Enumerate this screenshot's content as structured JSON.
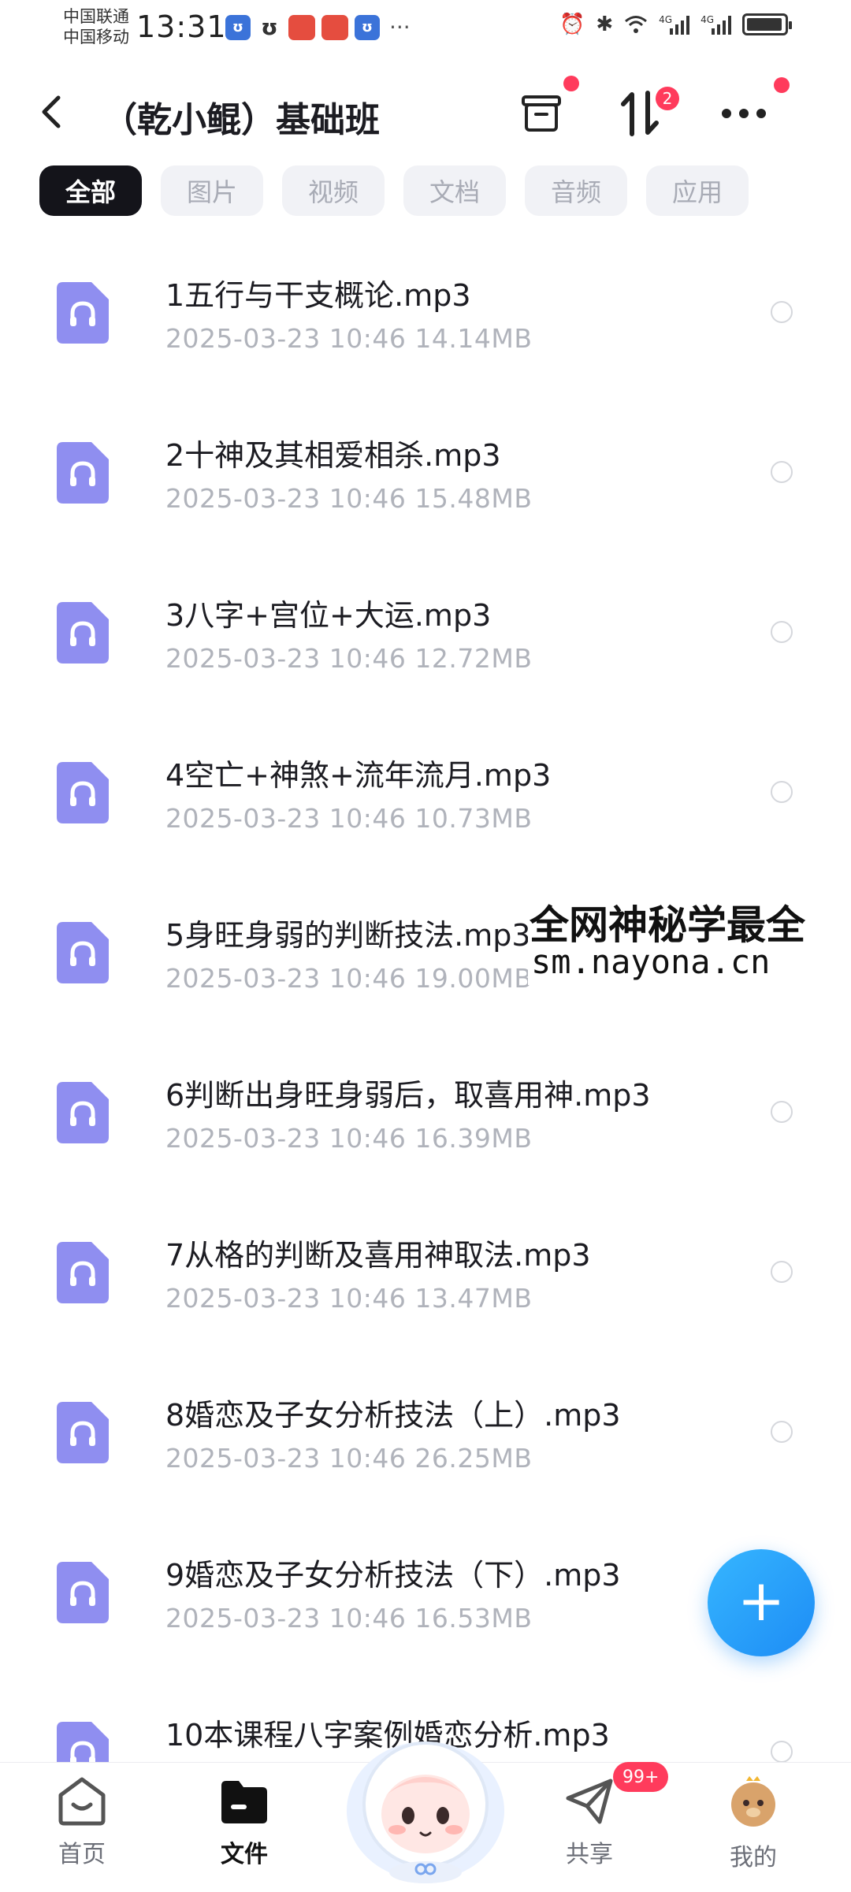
{
  "status_bar": {
    "carrier_1": "中国联通",
    "carrier_2": "中国移动",
    "time": "13:31",
    "more": "···"
  },
  "header": {
    "title": "（乾小鲲）基础班",
    "sort_badge": "2"
  },
  "tabs": [
    {
      "label": "全部",
      "active": true
    },
    {
      "label": "图片"
    },
    {
      "label": "视频"
    },
    {
      "label": "文档"
    },
    {
      "label": "音频"
    },
    {
      "label": "应用"
    }
  ],
  "files": [
    {
      "name": "1五行与干支概论.mp3",
      "date": "2025-03-23  10:46",
      "size": "14.14MB"
    },
    {
      "name": "2十神及其相爱相杀.mp3",
      "date": "2025-03-23  10:46",
      "size": "15.48MB"
    },
    {
      "name": "3八字+宫位+大运.mp3",
      "date": "2025-03-23  10:46",
      "size": "12.72MB"
    },
    {
      "name": "4空亡+神煞+流年流月.mp3",
      "date": "2025-03-23  10:46",
      "size": "10.73MB"
    },
    {
      "name": "5身旺身弱的判断技法.mp3",
      "date": "2025-03-23  10:46",
      "size": "19.00MB"
    },
    {
      "name": "6判断出身旺身弱后，取喜用神.mp3",
      "date": "2025-03-23  10:46",
      "size": "16.39MB"
    },
    {
      "name": "7从格的判断及喜用神取法.mp3",
      "date": "2025-03-23  10:46",
      "size": "13.47MB"
    },
    {
      "name": "8婚恋及子女分析技法（上）.mp3",
      "date": "2025-03-23  10:46",
      "size": "26.25MB"
    },
    {
      "name": "9婚恋及子女分析技法（下）.mp3",
      "date": "2025-03-23  10:46",
      "size": "16.53MB"
    },
    {
      "name": "10本课程八字案例婚恋分析.mp3",
      "date": "",
      "size": ""
    }
  ],
  "watermark": {
    "line1": "全网神秘学最全",
    "line2": "sm.nayona.cn"
  },
  "fab_icon": "+",
  "bottom_nav": {
    "home": "首页",
    "files": "文件",
    "share": "共享",
    "share_badge": "99+",
    "mine": "我的"
  },
  "colors": {
    "accent": "#1d8cf5",
    "file_icon": "#8f8ef0",
    "badge": "#ff3b5c"
  }
}
